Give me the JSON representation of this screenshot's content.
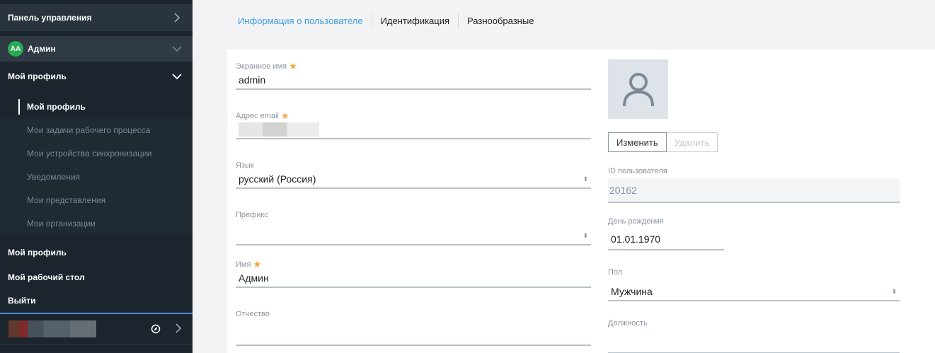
{
  "sidebar": {
    "top_label": "Панель управления",
    "user": {
      "initials": "AA",
      "name": "Админ"
    },
    "section_label": "Мой профиль",
    "sub_items": [
      {
        "label": "Мой профиль",
        "active": true
      },
      {
        "label": "Мои задачи рабочего процесса",
        "active": false
      },
      {
        "label": "Мои устройства синхронизации",
        "active": false
      },
      {
        "label": "Уведомления",
        "active": false
      },
      {
        "label": "Мои представления",
        "active": false
      },
      {
        "label": "Мои организации",
        "active": false
      }
    ],
    "links": [
      "Мой профиль",
      "Мой рабочий стол",
      "Выйти"
    ]
  },
  "tabs": [
    "Информация о пользователе",
    "Идентификация",
    "Разнообразные"
  ],
  "form": {
    "screen_name": {
      "label": "Экранное имя",
      "value": "admin"
    },
    "email": {
      "label": "Адрес email",
      "value": ""
    },
    "language": {
      "label": "Язык",
      "value": "русский (Россия)"
    },
    "prefix": {
      "label": "Префикс",
      "value": ""
    },
    "first_name": {
      "label": "Имя",
      "value": "Админ"
    },
    "middle_name": {
      "label": "Отчество",
      "value": ""
    },
    "user_id": {
      "label": "ID пользователя",
      "value": "20162"
    },
    "birthday": {
      "label": "День рождения",
      "value": "01.01.1970"
    },
    "gender": {
      "label": "Пол",
      "value": "Мужчина"
    },
    "job_title": {
      "label": "Должность",
      "value": ""
    }
  },
  "photo_buttons": {
    "change": "Изменить",
    "delete": "Удалить"
  },
  "colors": {
    "sidebar_bg": "#1c252d",
    "accent": "#3f9fe0",
    "avatar_green": "#2aab55",
    "required_star": "#f0a540"
  },
  "icons": {
    "chevron": "chevron-icon",
    "compass": "compass-icon",
    "user_placeholder": "user-icon",
    "select_arrows": "sort-arrows-icon"
  }
}
